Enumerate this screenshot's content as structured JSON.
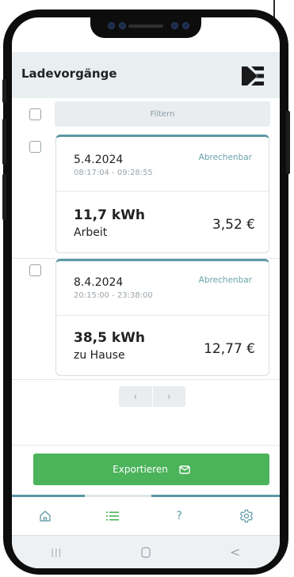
{
  "header": {
    "title": "Ladevorgänge"
  },
  "filter": {
    "label": "Filtern"
  },
  "sessions": [
    {
      "date": "5.4.2024",
      "time": "08:17:04 - 09:28:55",
      "status": "Abrechenbar",
      "energy": "11,7 kWh",
      "location": "Arbeit",
      "price": "3,52 €"
    },
    {
      "date": "8.4.2024",
      "time": "20:15:00 - 23:38:00",
      "status": "Abrechenbar",
      "energy": "38,5 kWh",
      "location": "zu Hause",
      "price": "12,77 €"
    }
  ],
  "pager": {
    "prev": "‹",
    "next": "›"
  },
  "export": {
    "label": "Exportieren"
  },
  "nav": {
    "help": "?"
  },
  "sysbar": {
    "recents": "|||",
    "back": "<"
  },
  "colors": {
    "accent": "#5b98a5",
    "green": "#4bb35a",
    "header_bg": "#e9eef1"
  },
  "icons": [
    "home-icon",
    "list-icon",
    "help-icon",
    "settings-icon",
    "mail-icon",
    "brand-logo"
  ]
}
